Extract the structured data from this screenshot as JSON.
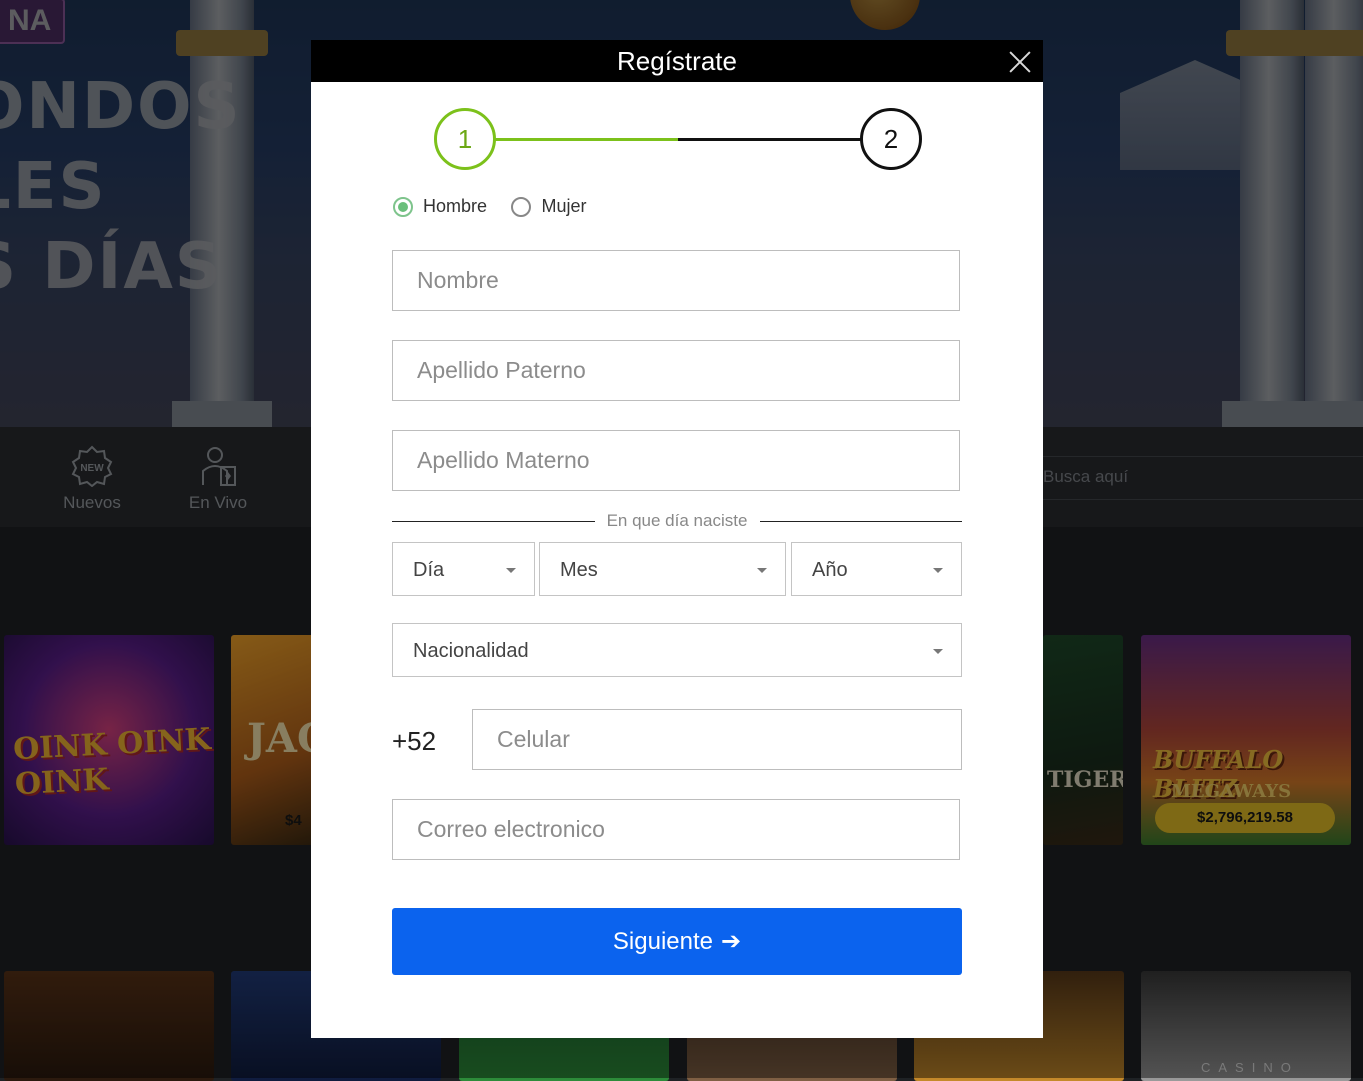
{
  "background": {
    "hero_badge": "NA",
    "hero_lines": [
      "ONDOS",
      "LES",
      "S DÍAS"
    ],
    "nav_items": [
      {
        "label": "Nuevos",
        "icon": "new-badge-icon"
      },
      {
        "label": "En Vivo",
        "icon": "live-dealer-icon"
      }
    ],
    "search_placeholder": "Busca aquí",
    "games": [
      {
        "title": "OINK OINK OINK",
        "jackpot": ""
      },
      {
        "title": "JAC",
        "jackpot": "$4"
      },
      {
        "title": "TIGER",
        "jackpot": ""
      },
      {
        "title": "BUFFALO BLITZ",
        "subtitle": "MEGAWAYS",
        "jackpot": "$2,796,219.58"
      }
    ],
    "live_label": "CASINO"
  },
  "modal": {
    "title": "Regístrate",
    "steps": [
      "1",
      "2"
    ],
    "gender_options": [
      {
        "label": "Hombre",
        "selected": true
      },
      {
        "label": "Mujer",
        "selected": false
      }
    ],
    "fields": {
      "nombre": {
        "placeholder": "Nombre",
        "value": ""
      },
      "apellido_paterno": {
        "placeholder": "Apellido Paterno",
        "value": ""
      },
      "apellido_materno": {
        "placeholder": "Apellido Materno",
        "value": ""
      },
      "celular": {
        "placeholder": "Celular",
        "value": ""
      },
      "correo": {
        "placeholder": "Correo electronico",
        "value": ""
      }
    },
    "birth_label": "En que día naciste",
    "birth_selects": {
      "day": "Día",
      "month": "Mes",
      "year": "Año"
    },
    "nationality": "Nacionalidad",
    "phone_prefix": "+52",
    "submit_label": "Siguiente",
    "submit_arrow": "➔"
  },
  "colors": {
    "accent_green": "#7cc11b",
    "primary_blue": "#0b63ee",
    "header_black": "#000000"
  }
}
